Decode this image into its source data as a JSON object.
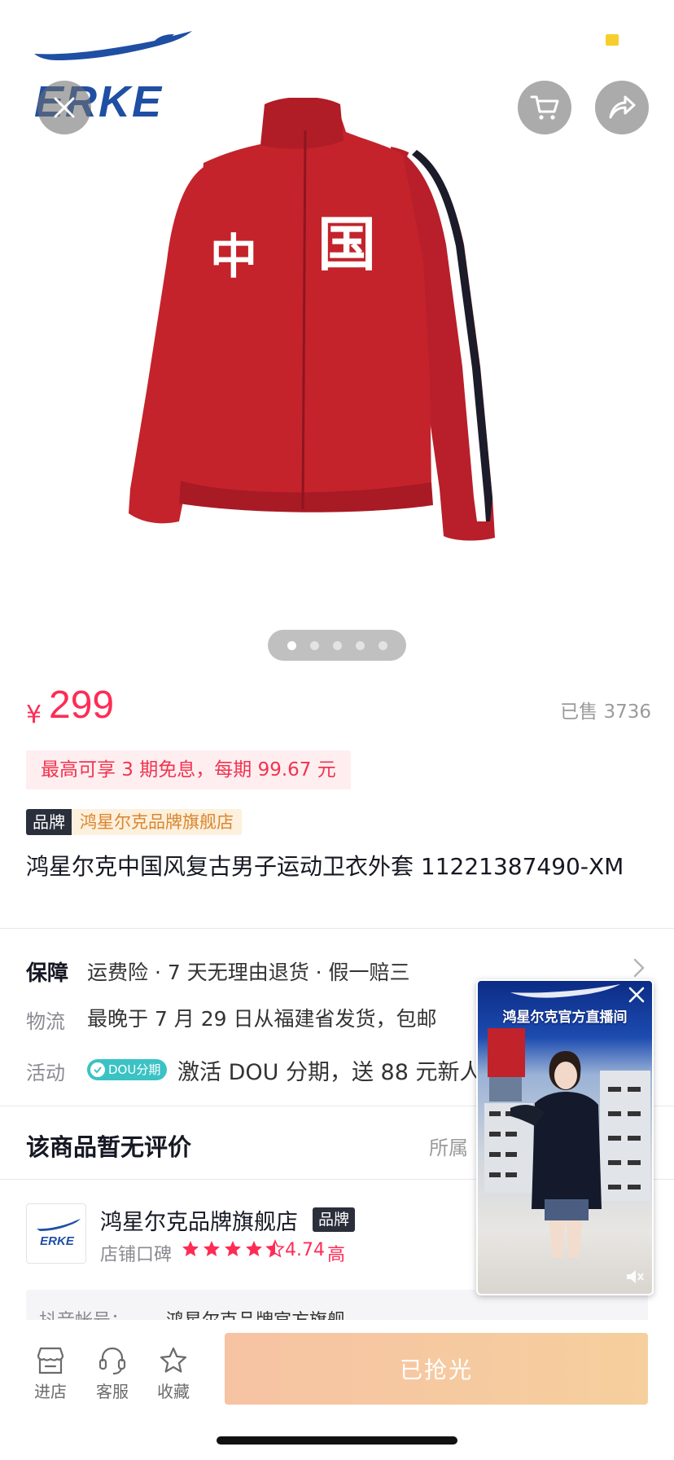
{
  "hero": {
    "brand_logo_text": "ERKE",
    "jacket_chest_text_left": "中",
    "jacket_chest_text_right": "国",
    "carousel": {
      "count": 5,
      "active_index": 0
    }
  },
  "price": {
    "currency": "¥",
    "amount": "299",
    "sold_label": "已售 3736"
  },
  "installment_text": "最高可享 3 期免息，每期 99.67 元",
  "brand_badge": "品牌",
  "store_tag": "鸿星尔克品牌旗舰店",
  "product_title": "鸿星尔克中国风复古男子运动卫衣外套 11221387490-XM",
  "services": {
    "guarantee": {
      "label": "保障",
      "value": "运费险 · 7 天无理由退货 · 假一赔三"
    },
    "logistics": {
      "label": "物流",
      "value": "最晚于 7 月 29 日从福建省发货，包邮"
    },
    "activity": {
      "label": "活动",
      "badge": "DOU分期",
      "value": "激活 DOU 分期，送 88 元新人"
    }
  },
  "reviews": {
    "title": "该商品暂无评价",
    "right_text": "所属"
  },
  "store": {
    "logo_text": "ERKE",
    "name": "鸿星尔克品牌旗舰店",
    "brand_badge": "品牌",
    "rating_label": "店铺口碑",
    "rating_value": 4.5,
    "rating_score": "4.74",
    "rating_level": "高"
  },
  "douyin_account": {
    "label": "抖音帐号：",
    "name": "鸿星尔克品牌官方旗舰"
  },
  "live_window": {
    "title": "鸿星尔克官方直播间"
  },
  "bottom_bar": {
    "tabs": [
      {
        "label": "进店",
        "icon": "store-icon"
      },
      {
        "label": "客服",
        "icon": "headset-icon"
      },
      {
        "label": "收藏",
        "icon": "star-icon"
      }
    ],
    "buy_button_label": "已抢光"
  },
  "colors": {
    "price_red": "#fe2c55",
    "brand_blue": "#1f4fa3",
    "jacket_red": "#c4232b",
    "buy_button": "#f6c7a0"
  }
}
